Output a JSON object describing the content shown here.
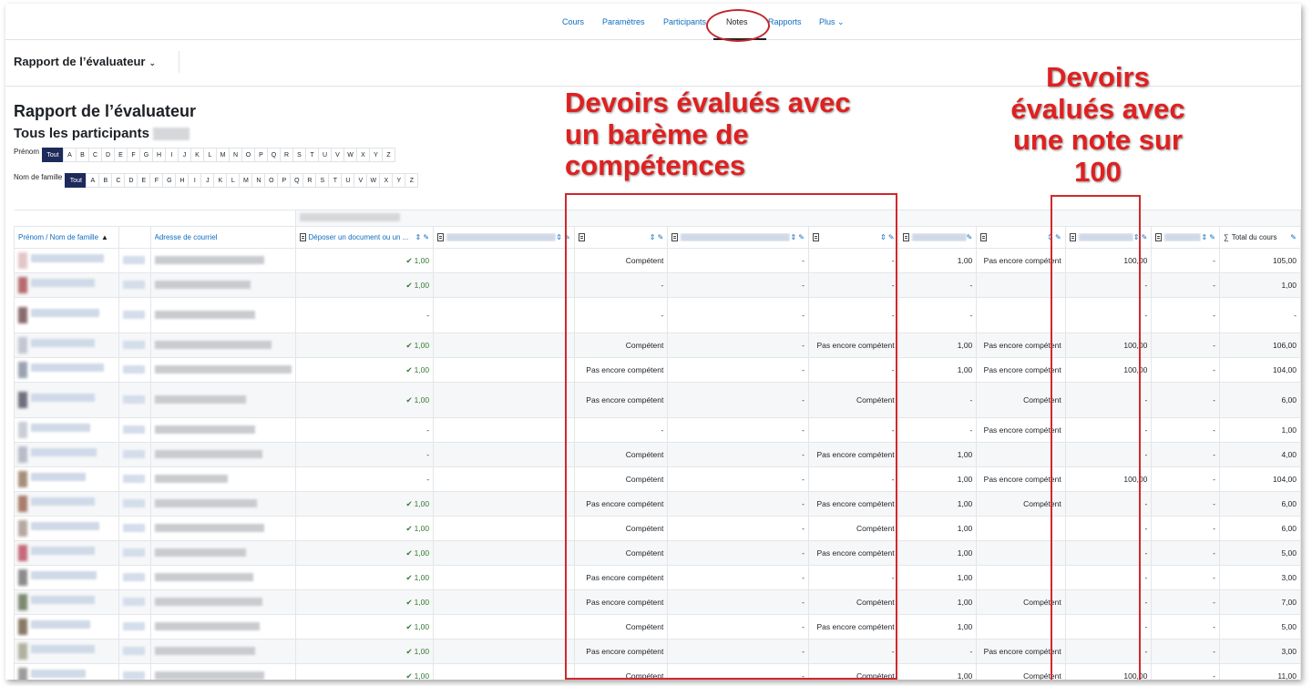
{
  "nav": {
    "items": [
      "Cours",
      "Paramètres",
      "Participants",
      "Notes",
      "Rapports",
      "Plus"
    ],
    "more_caret": "⌄"
  },
  "selector": {
    "label": "Rapport de l’évaluateur",
    "caret": "⌄"
  },
  "page_title": "Rapport de l’évaluateur",
  "subtitle": "Tous les participants",
  "filters": {
    "prenom_label": "Prénom",
    "nom_label": "Nom de famille",
    "tout": "Tout",
    "letters": [
      "A",
      "B",
      "C",
      "D",
      "E",
      "F",
      "G",
      "H",
      "I",
      "J",
      "K",
      "L",
      "M",
      "N",
      "O",
      "P",
      "Q",
      "R",
      "S",
      "T",
      "U",
      "V",
      "W",
      "X",
      "Y",
      "Z"
    ]
  },
  "annotations": {
    "left": "Devoirs évalués avec un barème de compétences",
    "right": "Devoirs évalués avec une note sur 100"
  },
  "colors": {
    "annotation": "#e02020",
    "link": "#0f6cbf",
    "check": "#357a32",
    "active_letter": "#1d2a5b"
  },
  "table": {
    "headers": {
      "name": "Prénom / Nom de famille",
      "sort_icon": "▲",
      "email": "Adresse de courriel",
      "col1": "Déposer un document ou un ...",
      "total": "Total du cours",
      "sum_icon": "∑"
    },
    "rows": [
      [
        "1,00",
        "",
        "Compétent",
        "-",
        "-",
        "1,00",
        "Pas encore compétent",
        "100,00",
        "-",
        "105,00"
      ],
      [
        "1,00",
        "",
        "-",
        "-",
        "-",
        "-",
        "",
        "-",
        "-",
        "1,00"
      ],
      [
        "-",
        "",
        "-",
        "-",
        "-",
        "-",
        "",
        "-",
        "-",
        "-"
      ],
      [
        "1,00",
        "",
        "Compétent",
        "-",
        "Pas encore compétent",
        "1,00",
        "Pas encore compétent",
        "100,00",
        "-",
        "106,00"
      ],
      [
        "1,00",
        "",
        "Pas encore compétent",
        "-",
        "-",
        "1,00",
        "Pas encore compétent",
        "100,00",
        "-",
        "104,00"
      ],
      [
        "1,00",
        "",
        "Pas encore compétent",
        "-",
        "Compétent",
        "-",
        "Compétent",
        "-",
        "-",
        "6,00"
      ],
      [
        "-",
        "",
        "-",
        "-",
        "-",
        "-",
        "Pas encore compétent",
        "-",
        "-",
        "1,00"
      ],
      [
        "-",
        "",
        "Compétent",
        "-",
        "Pas encore compétent",
        "1,00",
        "",
        "-",
        "-",
        "4,00"
      ],
      [
        "-",
        "",
        "Compétent",
        "-",
        "-",
        "1,00",
        "Pas encore compétent",
        "100,00",
        "-",
        "104,00"
      ],
      [
        "1,00",
        "",
        "Pas encore compétent",
        "-",
        "Pas encore compétent",
        "1,00",
        "Compétent",
        "-",
        "-",
        "6,00"
      ],
      [
        "1,00",
        "",
        "Compétent",
        "-",
        "Compétent",
        "1,00",
        "",
        "-",
        "-",
        "6,00"
      ],
      [
        "1,00",
        "",
        "Compétent",
        "-",
        "Pas encore compétent",
        "1,00",
        "",
        "-",
        "-",
        "5,00"
      ],
      [
        "1,00",
        "",
        "Pas encore compétent",
        "-",
        "-",
        "1,00",
        "",
        "-",
        "-",
        "3,00"
      ],
      [
        "1,00",
        "",
        "Pas encore compétent",
        "-",
        "Compétent",
        "1,00",
        "Compétent",
        "-",
        "-",
        "7,00"
      ],
      [
        "1,00",
        "",
        "Compétent",
        "-",
        "Pas encore compétent",
        "1,00",
        "",
        "-",
        "-",
        "5,00"
      ],
      [
        "1,00",
        "",
        "Pas encore compétent",
        "-",
        "-",
        "-",
        "Pas encore compétent",
        "-",
        "-",
        "3,00"
      ],
      [
        "1,00",
        "",
        "Compétent",
        "-",
        "Compétent",
        "1,00",
        "Compétent",
        "100,00",
        "-",
        "11,00"
      ]
    ]
  }
}
